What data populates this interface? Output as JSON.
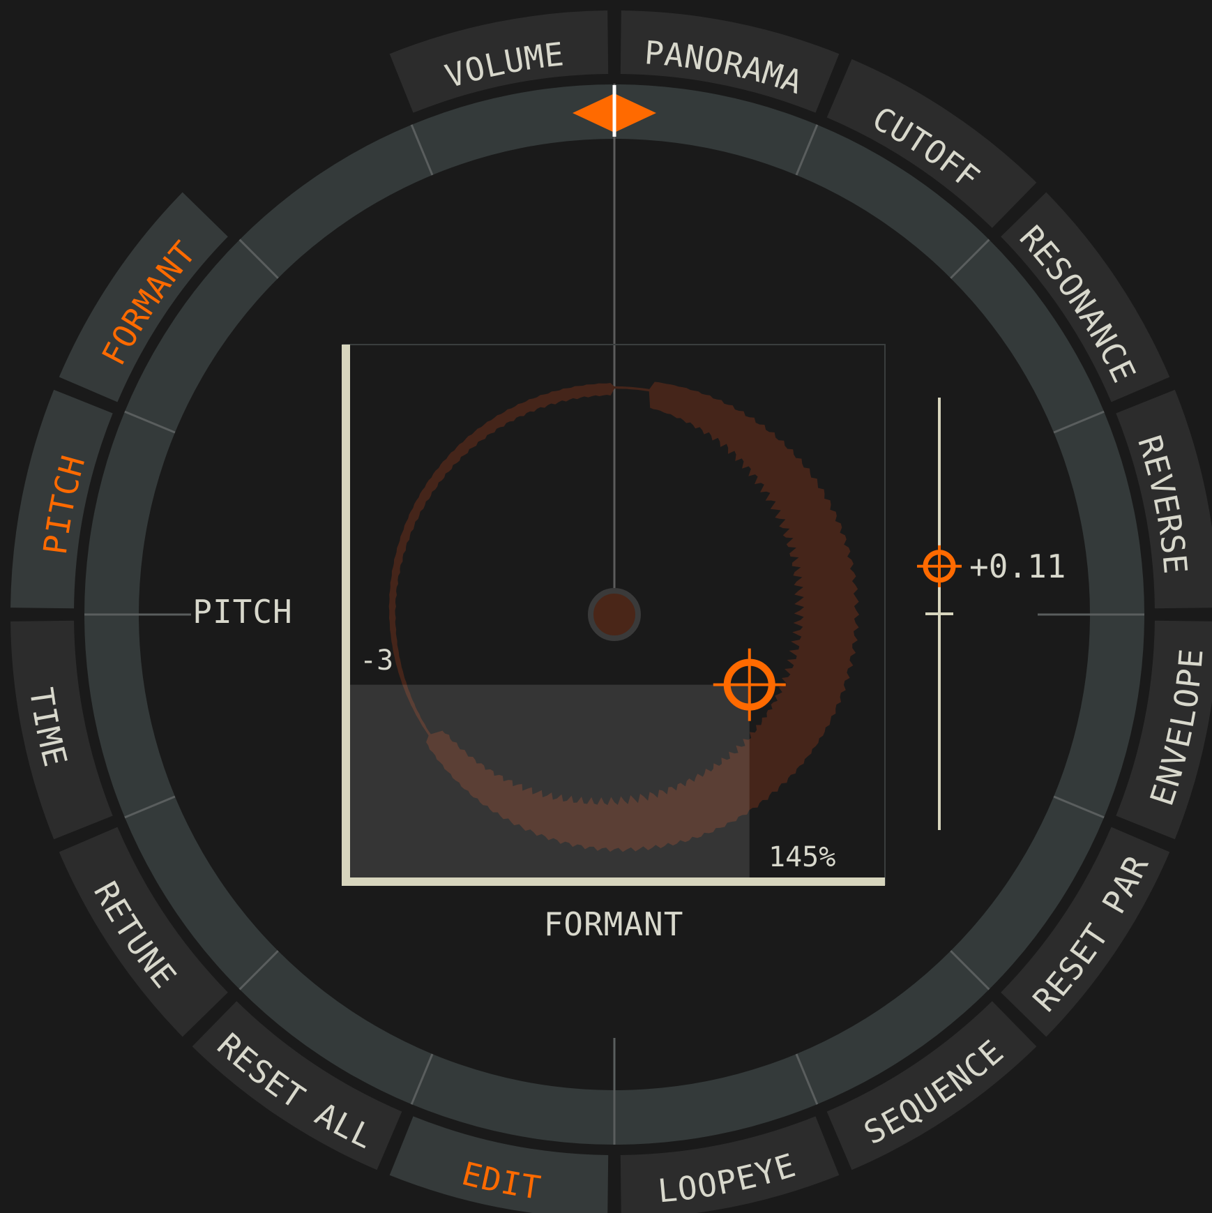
{
  "colors": {
    "background": "#1a1a1a",
    "segment": "#2c2c2c",
    "segment_active": "#353a3a",
    "inner_ring": "#343a3a",
    "tick": "#5a5e5e",
    "text": "#d8d8cc",
    "accent": "#ff6a00",
    "waveform": "#45251a",
    "waveform_highlight": "#5a3e33",
    "axis": "#d7d5bd",
    "region": "#333333"
  },
  "ring_buttons": [
    {
      "id": "volume",
      "label": "VOLUME",
      "active": false
    },
    {
      "id": "panorama",
      "label": "PANORAMA",
      "active": false
    },
    {
      "id": "cutoff",
      "label": "CUTOFF",
      "active": false
    },
    {
      "id": "resonance",
      "label": "RESONANCE",
      "active": false
    },
    {
      "id": "reverse",
      "label": "REVERSE",
      "active": false
    },
    {
      "id": "envelope",
      "label": "ENVELOPE",
      "active": false
    },
    {
      "id": "reset-par",
      "label": "RESET PAR",
      "active": false
    },
    {
      "id": "sequence",
      "label": "SEQUENCE",
      "active": false
    },
    {
      "id": "loopeye",
      "label": "LOOPEYE",
      "active": false
    },
    {
      "id": "edit",
      "label": "EDIT",
      "active": true
    },
    {
      "id": "reset-all",
      "label": "RESET ALL",
      "active": false
    },
    {
      "id": "retune",
      "label": "RETUNE",
      "active": false
    },
    {
      "id": "time",
      "label": "TIME",
      "active": false
    },
    {
      "id": "pitch",
      "label": "PITCH",
      "active": true
    },
    {
      "id": "formant",
      "label": "FORMANT",
      "active": true
    }
  ],
  "xy_pad": {
    "y_axis_label": "PITCH",
    "x_axis_label": "FORMANT",
    "pitch_value": "-3",
    "formant_value": "145%",
    "formant_fraction": 0.75,
    "pitch_fraction": 0.37
  },
  "side_slider": {
    "value_text": "+0.11",
    "value_fraction": 0.61
  },
  "playhead_icon": "playhead-diamond-icon",
  "crosshair_icon": "crosshair-icon"
}
